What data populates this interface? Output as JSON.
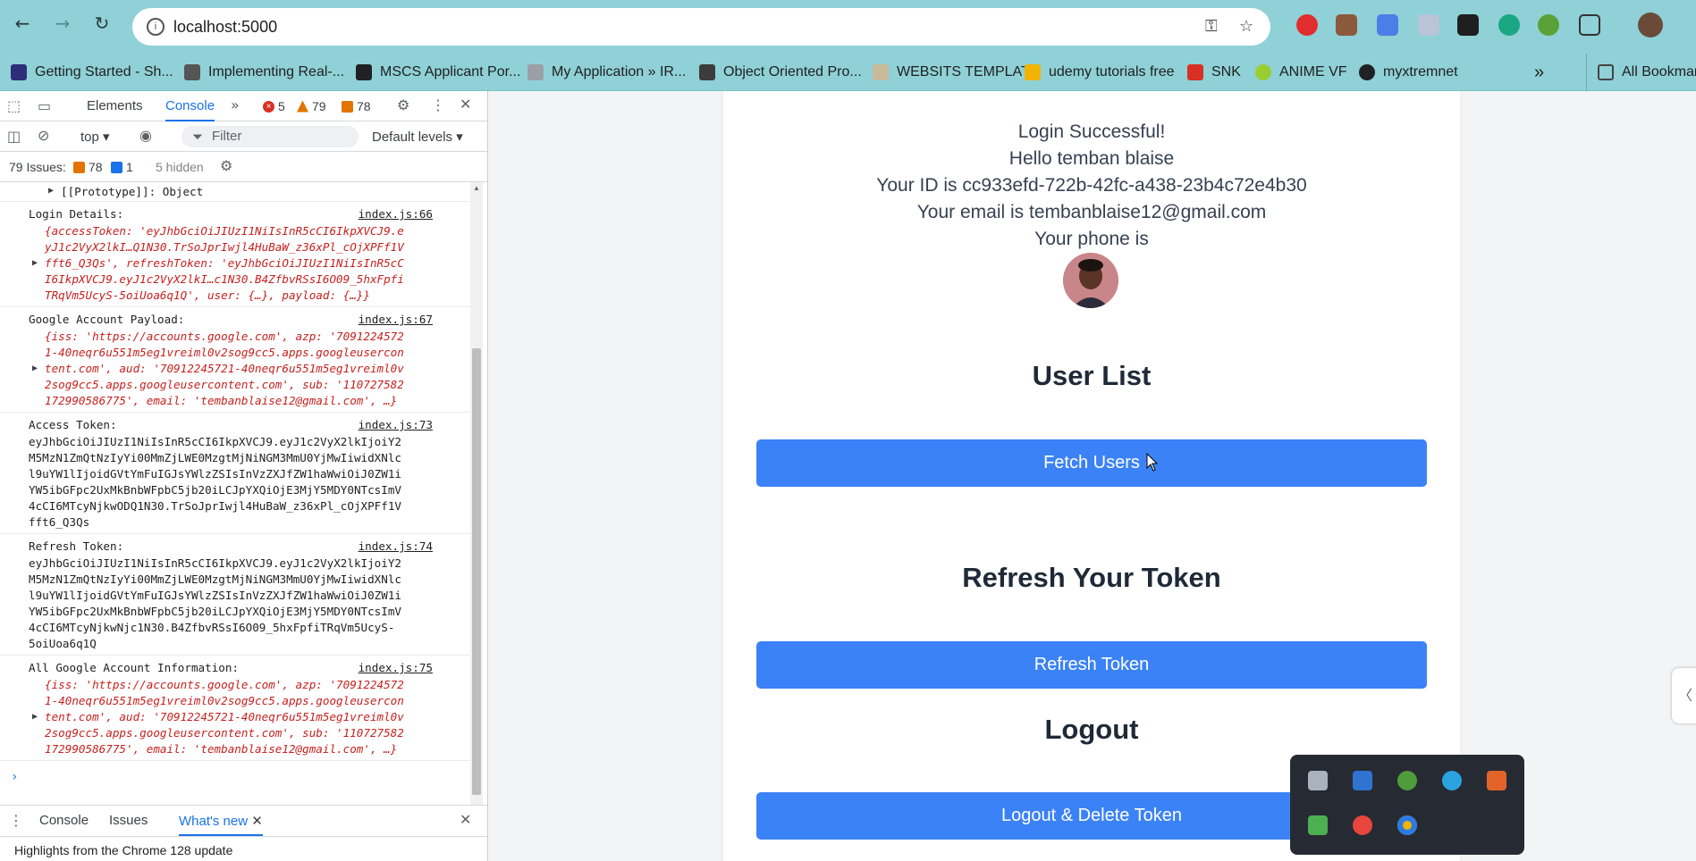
{
  "browser": {
    "url": "localhost:5000",
    "bookmarks": [
      {
        "label": "Getting Started - Sh...",
        "color": "#2d2d7a"
      },
      {
        "label": "Implementing Real-...",
        "color": "#555555"
      },
      {
        "label": "MSCS Applicant Por...",
        "color": "#202124"
      },
      {
        "label": "My Application » IR...",
        "color": "#9aa0a6"
      },
      {
        "label": "Object Oriented Pro...",
        "color": "#3c3c3c"
      },
      {
        "label": "WEBSITS TEMPLAT",
        "color": "#c8b99a"
      },
      {
        "label": "udemy tutorials free",
        "color": "#f2b400"
      },
      {
        "label": "SNK",
        "color": "#d93025"
      },
      {
        "label": "ANIME VF",
        "color": "#9acd32"
      },
      {
        "label": "myxtremnet",
        "color": "#202124"
      }
    ],
    "all_bookmarks": "All Bookmarks"
  },
  "devtools": {
    "tabs": [
      "Elements",
      "Console"
    ],
    "active_tab": "Console",
    "errors": "5",
    "warnings": "79",
    "issues_badge": "78",
    "context": "top",
    "filter_placeholder": "Filter",
    "levels": "Default levels",
    "issues_summary": {
      "label": "79 Issues:",
      "warn": "78",
      "info": "1",
      "hidden": "5 hidden"
    },
    "prototype_line": "[[Prototype]]: Object",
    "entries": [
      {
        "label": "Login Details:",
        "source": "index.js:66",
        "lines": [
          "{accessToken: 'eyJhbGciOiJIUzI1NiIsInR5cCI6IkpXVCJ9.e",
          "yJ1c2VyX2lkI…Q1N30.TrSoJprIwjl4HuBaW_z36xPl_cOjXPFf1V",
          "fft6_Q3Qs', refreshToken: 'eyJhbGciOiJIUzI1NiIsInR5cC",
          "I6IkpXVCJ9.eyJ1c2VyX2lkI…c1N30.B4ZfbvRSsI6O09_5hxFpfi",
          "TRqVm5UcyS-5oiUoa6q1Q', user: {…}, payload: {…}}"
        ]
      },
      {
        "label": "Google Account Payload:",
        "source": "index.js:67",
        "lines": [
          "{iss: 'https://accounts.google.com', azp: '7091224572",
          "1-40neqr6u551m5eg1vreiml0v2sog9cc5.apps.googleusercon",
          "tent.com', aud: '70912245721-40neqr6u551m5eg1vreiml0v",
          "2sog9cc5.apps.googleusercontent.com', sub: '110727582",
          "172990586775', email: 'tembanblaise12@gmail.com', …}"
        ]
      },
      {
        "label": "Access Token:",
        "source": "index.js:73",
        "lines": [
          "eyJhbGciOiJIUzI1NiIsInR5cCI6IkpXVCJ9.eyJ1c2VyX2lkIjoiY2",
          "M5MzN1ZmQtNzIyYi00MmZjLWE0MzgtMjNiNGM3MmU0YjMwIiwidXNlc",
          "l9uYW1lIjoidGVtYmFuIGJsYWlzZSIsInVzZXJfZW1haWwiOiJ0ZW1i",
          "YW5ibGFpc2UxMkBnbWFpbC5jb20iLCJpYXQiOjE3MjY5MDY0NTcsImV",
          "4cCI6MTcyNjkwODQ1N30.TrSoJprIwjl4HuBaW_z36xPl_cOjXPFf1V",
          "fft6_Q3Qs"
        ]
      },
      {
        "label": "Refresh Token:",
        "source": "index.js:74",
        "lines": [
          "eyJhbGciOiJIUzI1NiIsInR5cCI6IkpXVCJ9.eyJ1c2VyX2lkIjoiY2",
          "M5MzN1ZmQtNzIyYi00MmZjLWE0MzgtMjNiNGM3MmU0YjMwIiwidXNlc",
          "l9uYW1lIjoidGVtYmFuIGJsYWlzZSIsInVzZXJfZW1haWwiOiJ0ZW1i",
          "YW5ibGFpc2UxMkBnbWFpbC5jb20iLCJpYXQiOjE3MjY5MDY0NTcsImV",
          "4cCI6MTcyNjkwNjc1N30.B4ZfbvRSsI6O09_5hxFpfiTRqVm5UcyS-",
          "5oiUoa6q1Q"
        ]
      },
      {
        "label": "All Google Account Information:",
        "source": "index.js:75",
        "lines": [
          "{iss: 'https://accounts.google.com', azp: '7091224572",
          "1-40neqr6u551m5eg1vreiml0v2sog9cc5.apps.googleusercon",
          "tent.com', aud: '70912245721-40neqr6u551m5eg1vreiml0v",
          "2sog9cc5.apps.googleusercontent.com', sub: '110727582",
          "172990586775', email: 'tembanblaise12@gmail.com', …}"
        ]
      }
    ],
    "drawer_tabs": [
      "Console",
      "Issues",
      "What's new"
    ],
    "drawer_active": "What's new",
    "whats_new_text": "Highlights from the Chrome 128 update"
  },
  "page": {
    "login_status": "Login Successful!",
    "greeting": "Hello temban blaise",
    "user_id": "Your ID is cc933efd-722b-42fc-a438-23b4c72e4b30",
    "email": "Your email is tembanblaise12@gmail.com",
    "phone": "Your phone is",
    "user_list_title": "User List",
    "fetch_button": "Fetch Users",
    "refresh_title": "Refresh Your Token",
    "refresh_button": "Refresh Token",
    "logout_title": "Logout",
    "logout_button": "Logout & Delete Token"
  },
  "colors": {
    "toolbar": "#8fd1d6",
    "primary_button": "#3b82f6",
    "devtools_accent": "#1a73e8",
    "console_object": "#c5221f",
    "tray_bg": "#262b33"
  }
}
